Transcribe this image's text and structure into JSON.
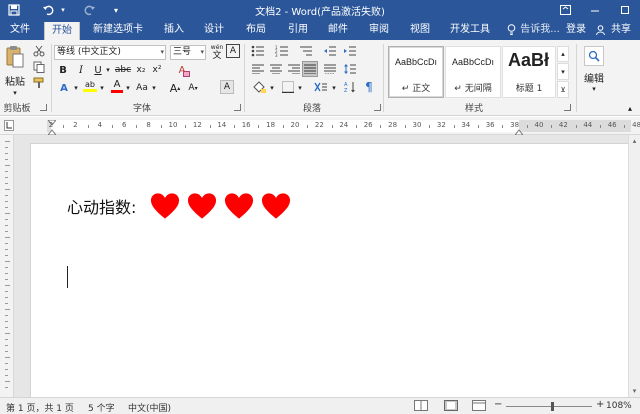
{
  "window": {
    "title": "文档2 - Word(产品激活失败)"
  },
  "quick_access": [
    {
      "name": "save-icon",
      "glyph": "💾"
    },
    {
      "name": "undo-icon",
      "glyph": "↶"
    },
    {
      "name": "redo-icon",
      "glyph": "↷"
    },
    {
      "name": "customize-quick-access-icon",
      "glyph": "▾"
    }
  ],
  "tabs": [
    {
      "label": "文件"
    },
    {
      "label": "开始"
    },
    {
      "label": "新建选项卡"
    },
    {
      "label": "插入"
    },
    {
      "label": "设计"
    },
    {
      "label": "布局"
    },
    {
      "label": "引用"
    },
    {
      "label": "邮件"
    },
    {
      "label": "审阅"
    },
    {
      "label": "视图"
    },
    {
      "label": "开发工具"
    }
  ],
  "tellme": {
    "label": "告诉我..."
  },
  "account": {
    "signin": "登录",
    "share": "共享"
  },
  "ribbon": {
    "clipboard": {
      "paste": "粘贴",
      "group": "剪贴板"
    },
    "font": {
      "name": "等线 (中文正文)",
      "size": "三号",
      "phonetic": "wén",
      "phonetic_base": "文",
      "bold": "B",
      "italic": "I",
      "underline": "U",
      "strike": "abc",
      "subscript": "x₂",
      "superscript": "x²",
      "char_border": "A",
      "clear_format": "A",
      "font_color": "A",
      "highlight": "ab",
      "char_shading": "Aa",
      "grow": "A",
      "shrink": "A",
      "group": "字体"
    },
    "paragraph": {
      "group": "段落"
    },
    "styles": {
      "cards": [
        {
          "sample": "AaBbCcDı",
          "name": "↵ 正文"
        },
        {
          "sample": "AaBbCcDı",
          "name": "↵ 无间隔"
        },
        {
          "sample": "AaBł",
          "name": "标题 1"
        }
      ],
      "group": "样式"
    },
    "editing": {
      "label": "编辑"
    }
  },
  "ruler": {
    "numbers": [
      "2",
      "2",
      "4",
      "6",
      "8",
      "10",
      "12",
      "14",
      "16",
      "18",
      "20",
      "22",
      "24",
      "26",
      "28",
      "30",
      "32",
      "34",
      "36",
      "38",
      "40",
      "42",
      "44",
      "46",
      "48"
    ]
  },
  "document": {
    "label": "心动指数:",
    "heart_count": 4,
    "heart_color": "#ff0000"
  },
  "status": {
    "page": "第 1 页，共 1 页",
    "words": "5 个字",
    "language": "中文(中国)",
    "zoom": "108%",
    "zoom_fraction": 0.54
  },
  "colors": {
    "accent": "#2b579a",
    "ribbon_bg": "#f3f3f3",
    "font_color_bar": "#ff0000",
    "highlight_bar": "#ffff00"
  }
}
